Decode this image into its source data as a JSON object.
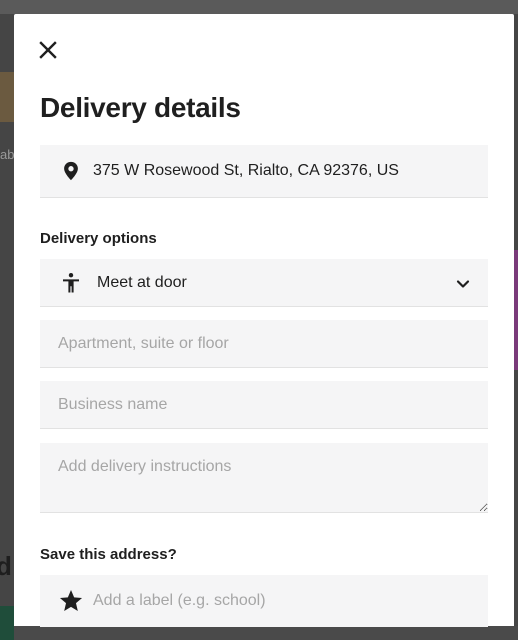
{
  "background": {
    "partial_text_left": "ab",
    "partial_heading_left": "d"
  },
  "modal": {
    "close_icon": "close-icon",
    "title": "Delivery details",
    "address": {
      "icon": "location-pin-icon",
      "value": "375 W Rosewood St, Rialto, CA 92376, US"
    },
    "delivery_options": {
      "label": "Delivery options",
      "icon": "person-standing-icon",
      "selected": "Meet at door",
      "chevron": "chevron-down-icon"
    },
    "apartment": {
      "placeholder": "Apartment, suite or floor",
      "value": ""
    },
    "business": {
      "placeholder": "Business name",
      "value": ""
    },
    "instructions": {
      "placeholder": "Add delivery instructions",
      "value": ""
    },
    "save_address": {
      "label": "Save this address?",
      "icon": "star-icon",
      "placeholder": "Add a label (e.g. school)",
      "value": ""
    }
  },
  "colors": {
    "field_bg": "#f5f5f6",
    "text": "#1f1f1f",
    "placeholder": "#a6a6a6",
    "overlay": "#4a4a4a"
  }
}
